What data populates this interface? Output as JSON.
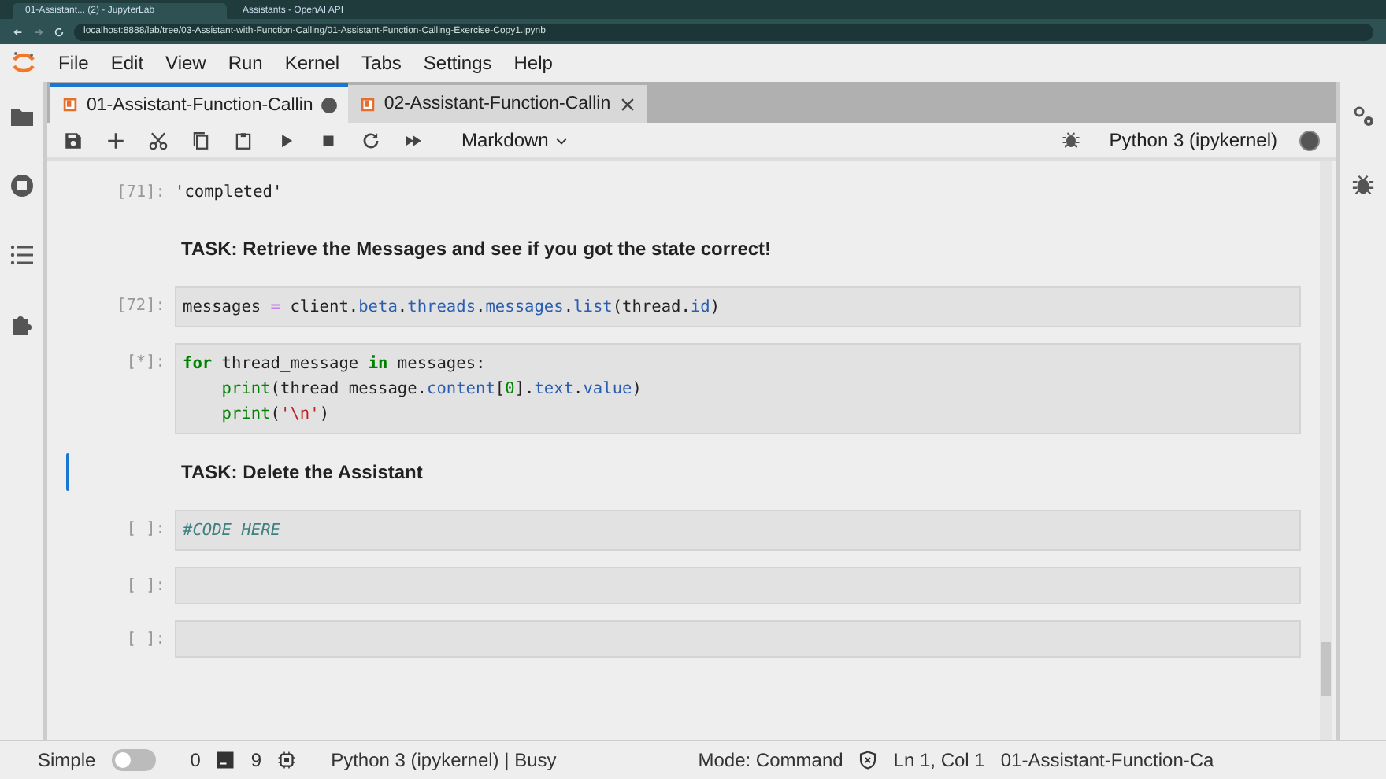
{
  "browser": {
    "tabs": [
      {
        "title": "01-Assistant... (2) - JupyterLab",
        "selected": true
      },
      {
        "title": "Assistants - OpenAI API",
        "selected": false
      }
    ],
    "url": "localhost:8888/lab/tree/03-Assistant-with-Function-Calling/01-Assistant-Function-Calling-Exercise-Copy1.ipynb"
  },
  "menu": [
    "File",
    "Edit",
    "View",
    "Run",
    "Kernel",
    "Tabs",
    "Settings",
    "Help"
  ],
  "notebook_tabs": [
    {
      "title": "01-Assistant-Function-Callin",
      "selected": true,
      "unsaved": true
    },
    {
      "title": "02-Assistant-Function-Callin",
      "selected": false,
      "unsaved": false
    }
  ],
  "toolbar": {
    "cell_type": "Markdown",
    "kernel": "Python 3 (ipykernel)",
    "kernel_busy": true
  },
  "cells": [
    {
      "kind": "output",
      "prompt": "[71]:",
      "text": "'completed'"
    },
    {
      "kind": "markdown",
      "text": "TASK: Retrieve the Messages and see if you got the state correct!",
      "active": false
    },
    {
      "kind": "code",
      "prompt": "[72]:",
      "lines": [
        {
          "indent": false,
          "tokens": [
            {
              "kind": "name",
              "text": "messages "
            },
            {
              "kind": "op",
              "text": "="
            },
            {
              "kind": "name",
              "text": " client."
            },
            {
              "kind": "attr",
              "text": "beta"
            },
            {
              "kind": "name",
              "text": "."
            },
            {
              "kind": "attr",
              "text": "threads"
            },
            {
              "kind": "name",
              "text": "."
            },
            {
              "kind": "attr",
              "text": "messages"
            },
            {
              "kind": "name",
              "text": "."
            },
            {
              "kind": "attr",
              "text": "list"
            },
            {
              "kind": "name",
              "text": "(thread."
            },
            {
              "kind": "attr",
              "text": "id"
            },
            {
              "kind": "name",
              "text": ")"
            }
          ]
        }
      ]
    },
    {
      "kind": "code",
      "prompt": "[*]:",
      "lines": [
        {
          "indent": false,
          "tokens": [
            {
              "kind": "kw",
              "text": "for"
            },
            {
              "kind": "name",
              "text": " thread_message "
            },
            {
              "kind": "kw",
              "text": "in"
            },
            {
              "kind": "name",
              "text": " messages:"
            }
          ]
        },
        {
          "indent": true,
          "tokens": [
            {
              "kind": "builtin",
              "text": "print"
            },
            {
              "kind": "name",
              "text": "(thread_message."
            },
            {
              "kind": "attr",
              "text": "content"
            },
            {
              "kind": "name",
              "text": "["
            },
            {
              "kind": "num",
              "text": "0"
            },
            {
              "kind": "name",
              "text": "]."
            },
            {
              "kind": "attr",
              "text": "text"
            },
            {
              "kind": "name",
              "text": "."
            },
            {
              "kind": "attr",
              "text": "value"
            },
            {
              "kind": "name",
              "text": ")"
            }
          ]
        },
        {
          "indent": true,
          "tokens": [
            {
              "kind": "builtin",
              "text": "print"
            },
            {
              "kind": "name",
              "text": "("
            },
            {
              "kind": "str",
              "text": "'\\n'"
            },
            {
              "kind": "name",
              "text": ")"
            }
          ]
        }
      ]
    },
    {
      "kind": "markdown",
      "text": "TASK: Delete the Assistant",
      "active": true
    },
    {
      "kind": "code",
      "prompt": "[ ]:",
      "lines": [
        {
          "indent": false,
          "tokens": [
            {
              "kind": "comment",
              "text": "#CODE HERE"
            }
          ]
        }
      ]
    },
    {
      "kind": "code",
      "prompt": "[ ]:"
    },
    {
      "kind": "code",
      "prompt": "[ ]:"
    }
  ],
  "status_bar": {
    "simple_label": "Simple",
    "simple_on": false,
    "terminals": "0",
    "kernels": "9",
    "kernel_status": "Python 3 (ipykernel) | Busy",
    "mode": "Mode: Command",
    "position": "Ln 1, Col 1",
    "file": "01-Assistant-Function-Ca"
  }
}
